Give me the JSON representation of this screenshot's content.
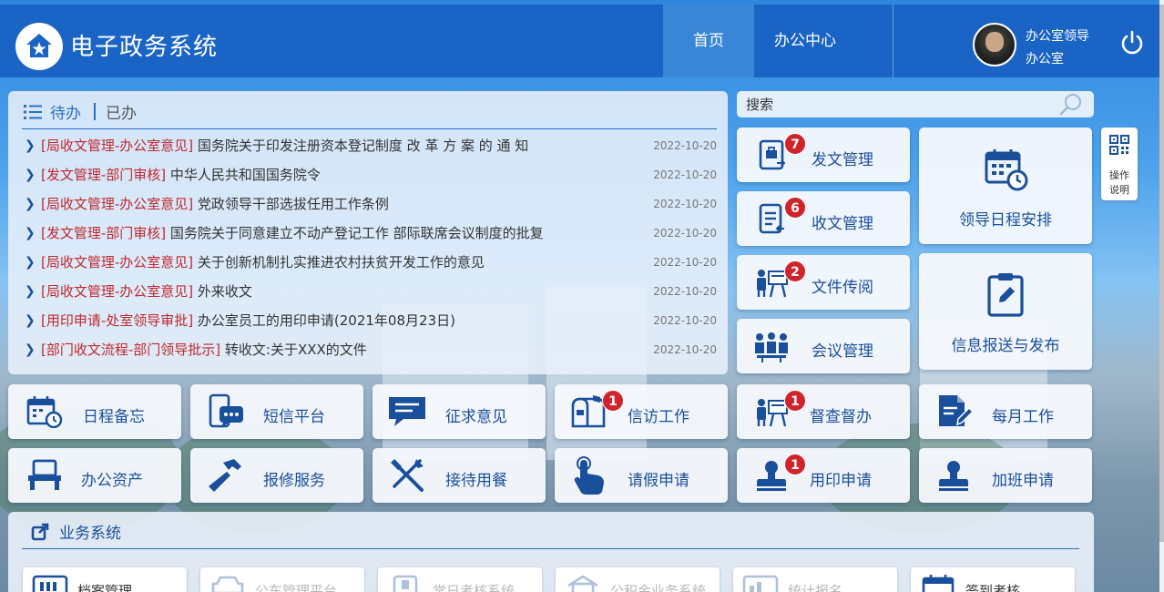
{
  "header": {
    "app_title": "电子政务系统",
    "nav": [
      {
        "label": "首页",
        "active": true
      },
      {
        "label": "办公中心",
        "active": false
      }
    ],
    "user": {
      "name": "办公室领导",
      "dept": "办公室"
    }
  },
  "todo": {
    "tabs": {
      "pending": "待办",
      "done": "已办"
    },
    "items": [
      {
        "category": "[局收文管理-办公室意见]",
        "title": "国务院关于印发注册资本登记制度 改 革 方 案 的 通 知",
        "date": "2022-10-20"
      },
      {
        "category": "[发文管理-部门审核]",
        "title": "中华人民共和国国务院令",
        "date": "2022-10-20"
      },
      {
        "category": "[局收文管理-办公室意见]",
        "title": "党政领导干部选拔任用工作条例",
        "date": "2022-10-20"
      },
      {
        "category": "[发文管理-部门审核]",
        "title": "国务院关于同意建立不动产登记工作 部际联席会议制度的批复",
        "date": "2022-10-20"
      },
      {
        "category": "[局收文管理-办公室意见]",
        "title": "关于创新机制扎实推进农村扶贫开发工作的意见",
        "date": "2022-10-20"
      },
      {
        "category": "[局收文管理-办公室意见]",
        "title": "外来收文",
        "date": "2022-10-20"
      },
      {
        "category": "[用印申请-处室领导审批]",
        "title": "办公室员工的用印申请(2021年08月23日)",
        "date": "2022-10-20"
      },
      {
        "category": "[部门收文流程-部门领导批示]",
        "title": "转收文:关于XXX的文件",
        "date": "2022-10-20"
      }
    ]
  },
  "search": {
    "placeholder": "搜索"
  },
  "tiles": {
    "fawen": {
      "label": "发文管理",
      "badge": "7"
    },
    "shouwen": {
      "label": "收文管理",
      "badge": "6"
    },
    "chuanyue": {
      "label": "文件传阅",
      "badge": "2"
    },
    "huiyi": {
      "label": "会议管理"
    },
    "richeng_leader": {
      "label": "领导日程安排"
    },
    "xinxi": {
      "label": "信息报送与发布"
    },
    "beiwang": {
      "label": "日程备忘"
    },
    "duanxin": {
      "label": "短信平台"
    },
    "zhengqiu": {
      "label": "征求意见"
    },
    "xinfang": {
      "label": "信访工作",
      "badge": "1"
    },
    "ducha": {
      "label": "督查督办",
      "badge": "1"
    },
    "meiyue": {
      "label": "每月工作"
    },
    "zichan": {
      "label": "办公资产"
    },
    "baoxiu": {
      "label": "报修服务"
    },
    "jiedai": {
      "label": "接待用餐"
    },
    "qingjia": {
      "label": "请假申请"
    },
    "yongyin": {
      "label": "用印申请",
      "badge": "1"
    },
    "jiaban": {
      "label": "加班申请"
    }
  },
  "help": {
    "line1": "操作",
    "line2": "说明"
  },
  "biz": {
    "title": "业务系统",
    "systems": [
      "档案管理",
      "公车管理平台",
      "常日考核系统",
      "公积金业务系统",
      "统计报名",
      "签到考核"
    ]
  },
  "colors": {
    "header": "#1a64c6",
    "accent": "#1a4f9c",
    "badge": "#d0232a",
    "category": "#c0282d"
  }
}
